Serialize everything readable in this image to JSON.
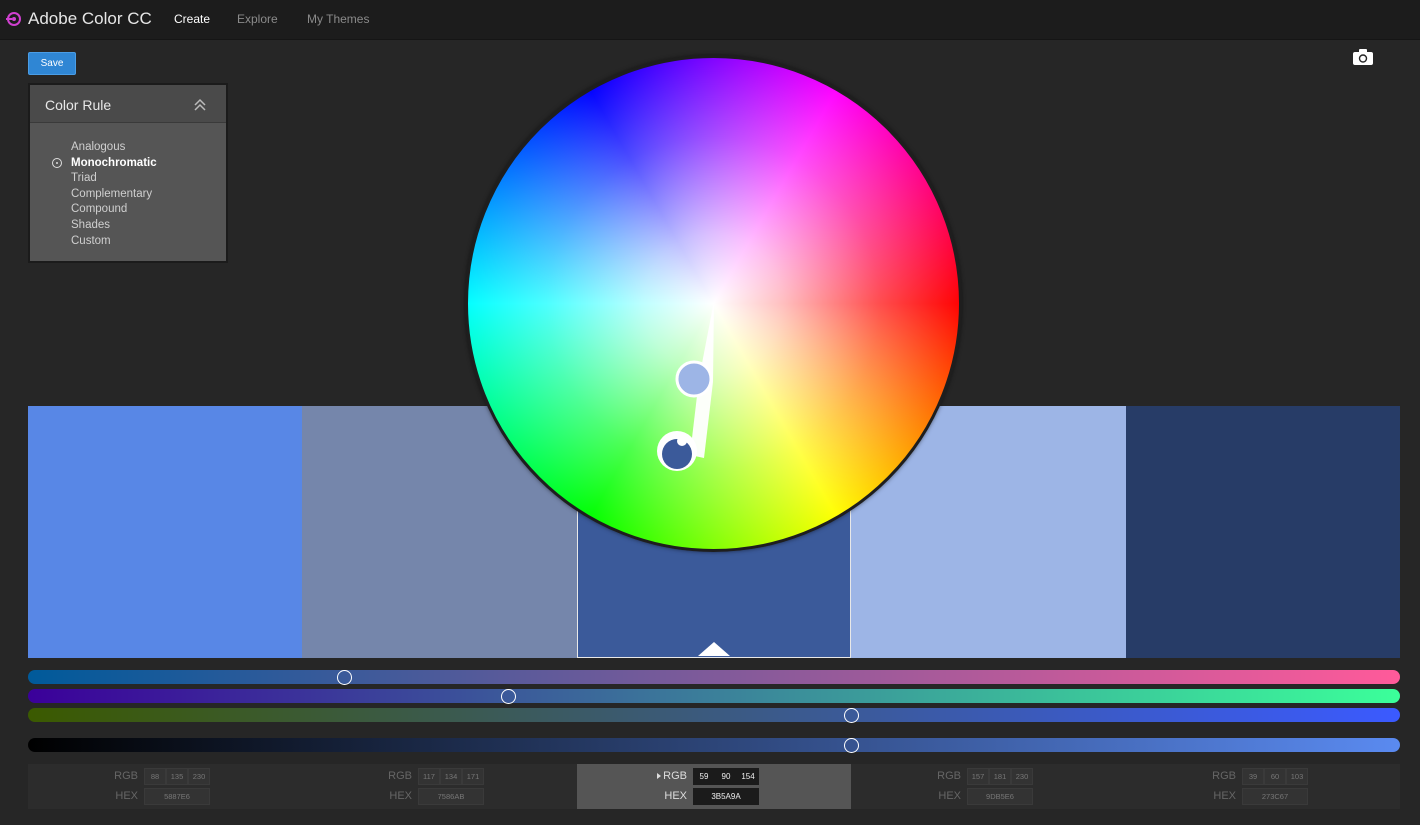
{
  "app": {
    "title": "Adobe Color CC"
  },
  "nav": {
    "create": "Create",
    "explore": "Explore",
    "my_themes": "My Themes"
  },
  "toolbar": {
    "save_label": "Save",
    "camera_icon": "camera-icon"
  },
  "color_rule": {
    "title": "Color Rule",
    "options": [
      "Analogous",
      "Monochromatic",
      "Triad",
      "Complementary",
      "Compound",
      "Shades",
      "Custom"
    ],
    "selected": "Monochromatic"
  },
  "swatches": [
    {
      "color": "#5887E6",
      "rgb": [
        "88",
        "135",
        "230"
      ],
      "hex": "5887E6"
    },
    {
      "color": "#7586AB",
      "rgb": [
        "117",
        "134",
        "171"
      ],
      "hex": "7586AB"
    },
    {
      "color": "#3B5A9A",
      "rgb": [
        "59",
        "90",
        "154"
      ],
      "hex": "3B5A9A"
    },
    {
      "color": "#9DB5E6",
      "rgb": [
        "157",
        "181",
        "230"
      ],
      "hex": "9DB5E6"
    },
    {
      "color": "#273C67",
      "rgb": [
        "39",
        "60",
        "103"
      ],
      "hex": "273C67"
    }
  ],
  "active_swatch": 2,
  "labels": {
    "rgb": "RGB",
    "hex": "HEX"
  },
  "sliders": {
    "red": 0.23,
    "green": 0.35,
    "blue": 0.6,
    "brightness": 0.6
  }
}
